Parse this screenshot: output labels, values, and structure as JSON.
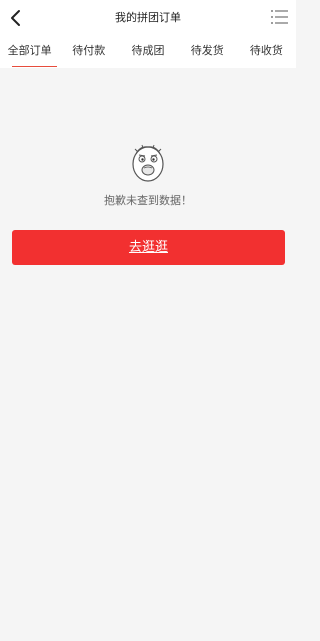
{
  "header": {
    "title": "我的拼团订单"
  },
  "tabs": [
    {
      "label": "全部订单",
      "active": true
    },
    {
      "label": "待付款",
      "active": false
    },
    {
      "label": "待成团",
      "active": false
    },
    {
      "label": "待发货",
      "active": false
    },
    {
      "label": "待收货",
      "active": false
    }
  ],
  "empty_state": {
    "message": "抱歉未查到数据！",
    "icon": "sad-face-icon"
  },
  "cta": {
    "label": "去逛逛"
  },
  "colors": {
    "accent": "#f23030",
    "tab_indicator": "#e74c3c",
    "background": "#f5f5f5"
  }
}
